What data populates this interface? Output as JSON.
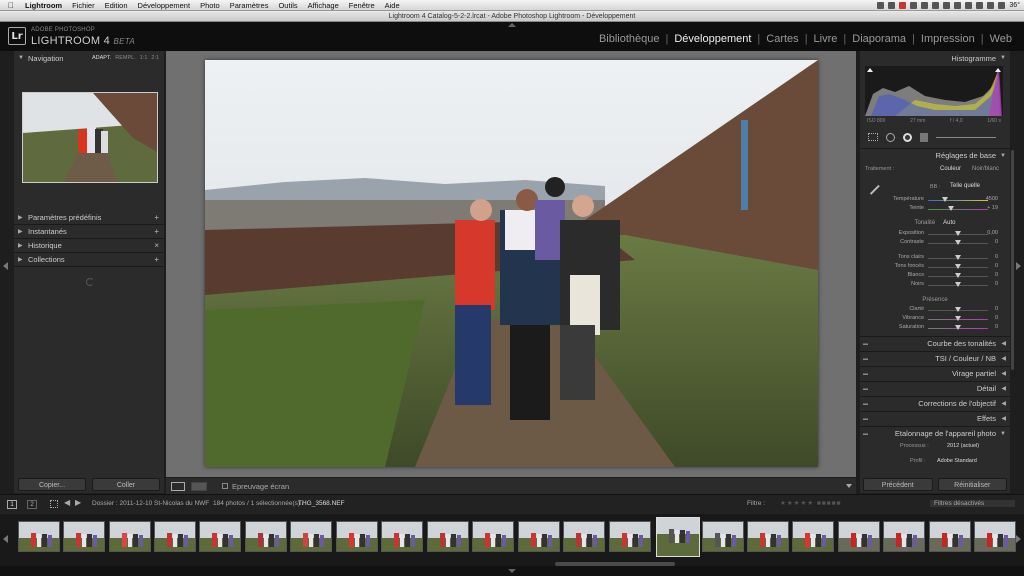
{
  "menubar": {
    "apple": "",
    "items": [
      "Lightroom",
      "Fichier",
      "Edition",
      "Développement",
      "Photo",
      "Paramètres",
      "Outils",
      "Affichage",
      "Fenêtre",
      "Aide"
    ],
    "temperature": "36°"
  },
  "window_title": "Lightroom 4 Catalog-5-2-2.lrcat - Adobe Photoshop Lightroom - Développement",
  "identity": {
    "logo": "Lr",
    "brand_small": "ADOBE PHOTOSHOP",
    "brand_big": "LIGHTROOM 4",
    "brand_beta": "BETA"
  },
  "modules": [
    "Bibliothèque",
    "Développement",
    "Cartes",
    "Livre",
    "Diaporama",
    "Impression",
    "Web"
  ],
  "left": {
    "navigator": "Navigation",
    "nav_options": [
      "ADAPT.",
      "REMPL.",
      "1:1",
      "2:1"
    ],
    "panels": [
      {
        "label": "Paramètres prédéfinis",
        "action": "+"
      },
      {
        "label": "Instantanés",
        "action": "+"
      },
      {
        "label": "Historique",
        "action": "×"
      },
      {
        "label": "Collections",
        "action": "+"
      }
    ],
    "copy_button": "Copier...",
    "paste_button": "Coller"
  },
  "toolbar": {
    "proof_label": "Epreuvage écran"
  },
  "right": {
    "histogram": "Histogramme",
    "histo_info": [
      "ISO 800",
      "27 mm",
      "f / 4,0",
      "1/60 s"
    ],
    "basic": "Réglages de base",
    "treatment_label": "Traitement :",
    "treatment_color": "Couleur",
    "treatment_bw": "Noir/blanc",
    "wb_label": "BB :",
    "wb_value": "Telle quelle",
    "temperature": {
      "label": "Température",
      "value": "4500"
    },
    "tint": {
      "label": "Teinte",
      "value": "+ 19"
    },
    "tone_label": "Tonalité",
    "auto_label": "Auto",
    "tone_sliders": [
      {
        "label": "Exposition",
        "value": "0,00"
      },
      {
        "label": "Contraste",
        "value": "0"
      },
      {
        "label": "Tons clairs",
        "value": "0"
      },
      {
        "label": "Tons foncés",
        "value": "0"
      },
      {
        "label": "Blancs",
        "value": "0"
      },
      {
        "label": "Noirs",
        "value": "0"
      }
    ],
    "presence_label": "Présence",
    "presence_sliders": [
      {
        "label": "Clarté",
        "value": "0"
      },
      {
        "label": "Vibrance",
        "value": "0"
      },
      {
        "label": "Saturation",
        "value": "0"
      }
    ],
    "sections": [
      "Courbe des tonalités",
      "TSI / Couleur / NB",
      "Virage partiel",
      "Détail",
      "Corrections de l'objectif",
      "Effets",
      "Etalonnage de l'appareil photo"
    ],
    "process_label": "Processus :",
    "process_value": "2012 (actuel)",
    "profile_label": "Profil :",
    "profile_value": "Adobe Standard",
    "prev_button": "Précédent",
    "reset_button": "Réinitialiser"
  },
  "filmbar": {
    "pages": [
      "1",
      "2"
    ],
    "folder": "Dossier : 2011-12-10 St-Nicolas du NWF",
    "count": "184 photos / 1 sélectionnée(s) /",
    "file": "THG_3568.NEF",
    "filter_label": "Filtre :",
    "filter_value": "Filtres désactivés"
  },
  "colors": {
    "accent": "#eeeeee",
    "panel": "#2b2b2b",
    "canvas": "#707070"
  }
}
